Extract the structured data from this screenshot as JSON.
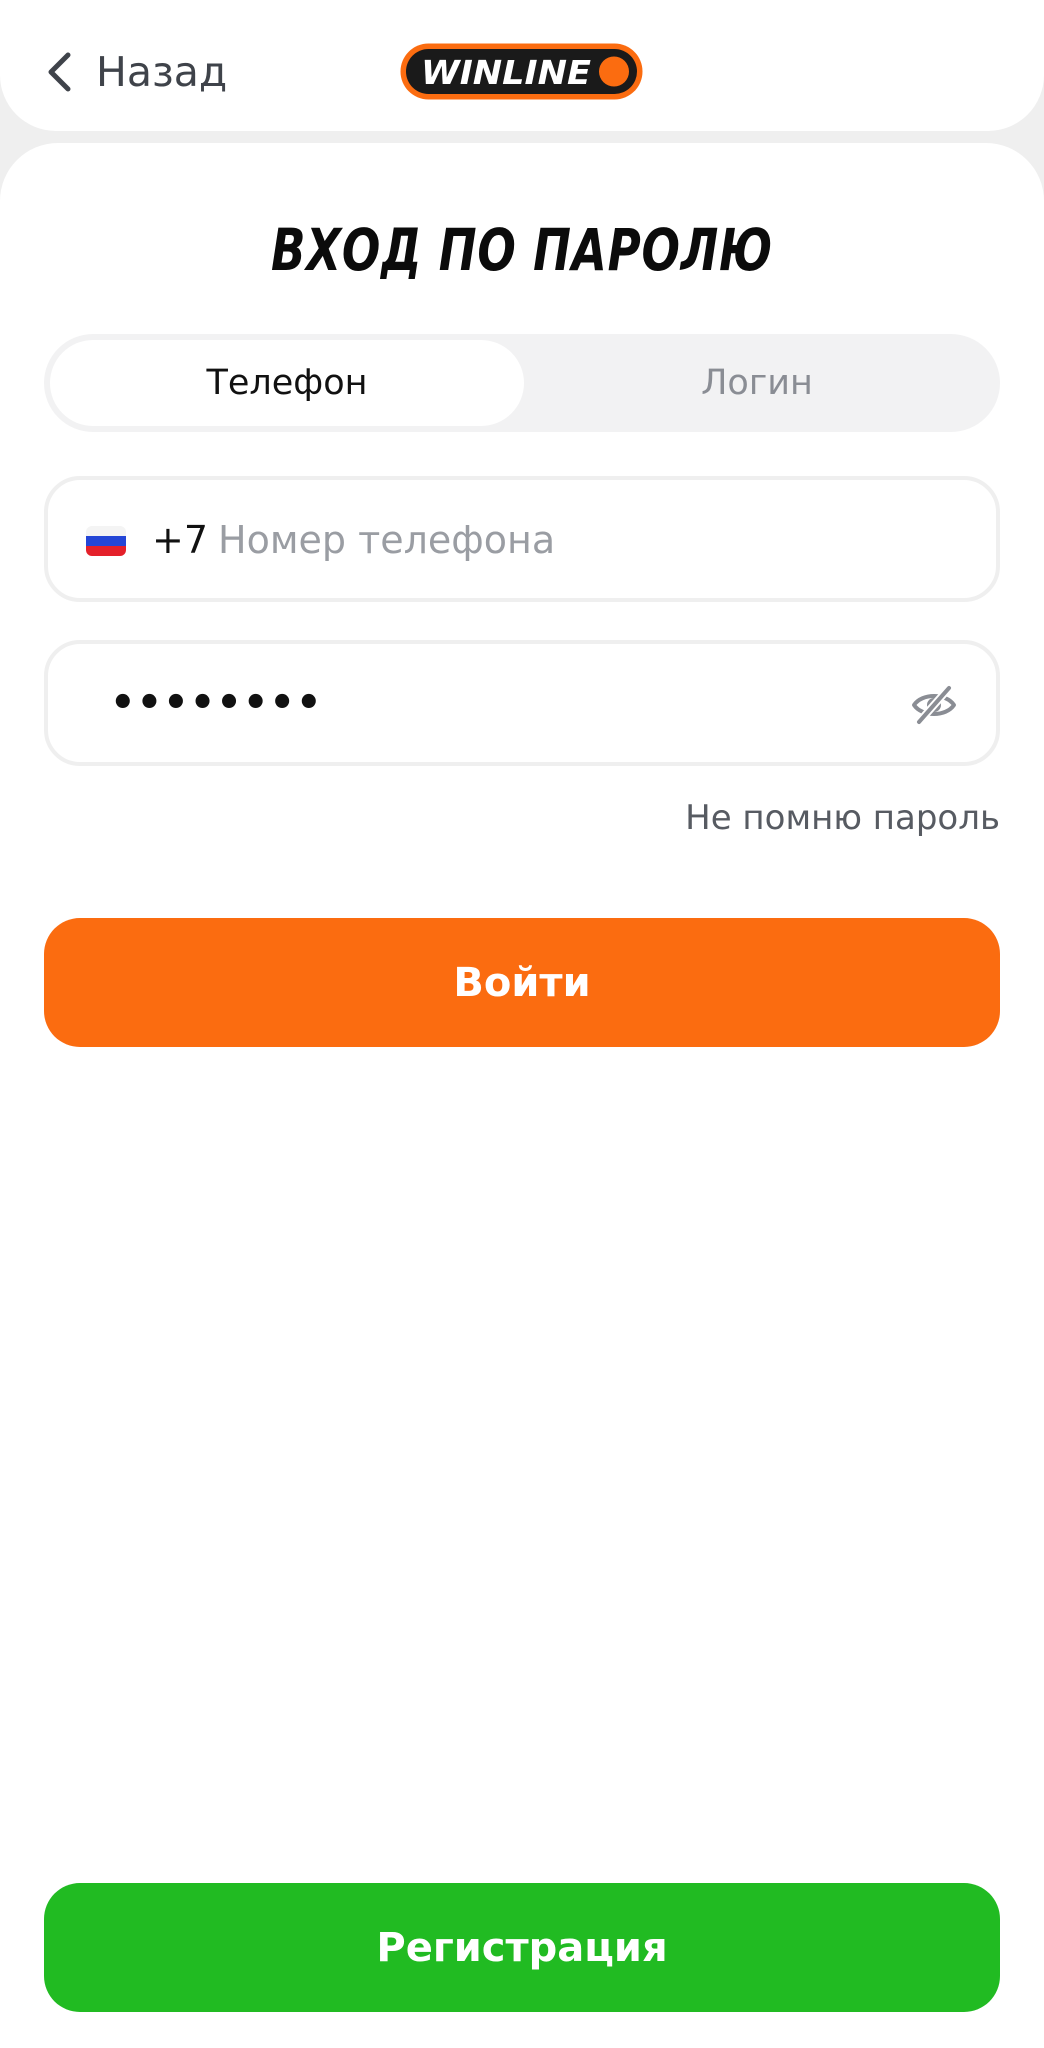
{
  "header": {
    "back_label": "Назад",
    "logo_text": "WINLINE"
  },
  "form": {
    "title": "ВХОД ПО ПАРОЛЮ",
    "tabs": [
      {
        "label": "Телефон",
        "selected": true
      },
      {
        "label": "Логин",
        "selected": false
      }
    ],
    "phone": {
      "prefix": "+7",
      "placeholder": "Номер телефона",
      "value": ""
    },
    "password": {
      "masked_value": "••••••••"
    },
    "forgot_label": "Не помню пароль",
    "submit_label": "Войти"
  },
  "footer": {
    "register_label": "Регистрация"
  },
  "icons": {
    "back": "chevron-left-icon",
    "flag": "russia-flag-icon",
    "visibility": "eye-off-icon"
  },
  "colors": {
    "accent_orange": "#fb6c10",
    "register_green": "#21bb22",
    "page_background": "#efefef",
    "logo_dark": "#1a1a1a"
  }
}
